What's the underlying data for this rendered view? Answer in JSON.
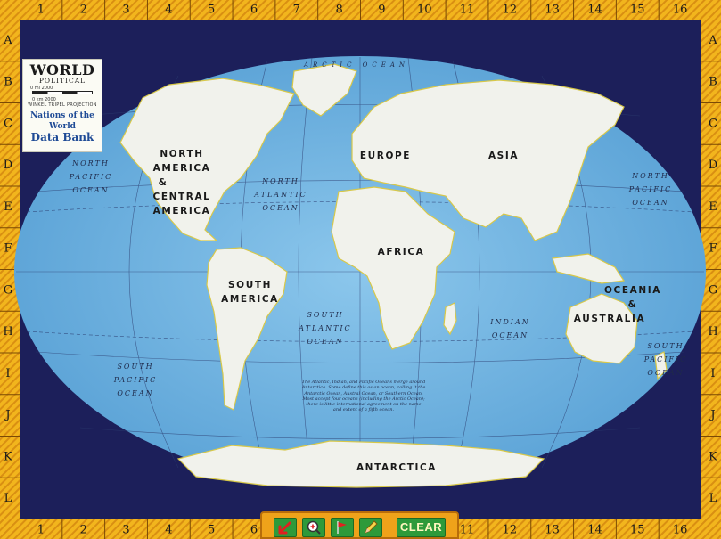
{
  "grid": {
    "columns": [
      "1",
      "2",
      "3",
      "4",
      "5",
      "6",
      "7",
      "8",
      "9",
      "10",
      "11",
      "12",
      "13",
      "14",
      "15",
      "16"
    ],
    "rows": [
      "A",
      "B",
      "C",
      "D",
      "E",
      "F",
      "G",
      "H",
      "I",
      "J",
      "K",
      "L"
    ]
  },
  "legend": {
    "title": "WORLD",
    "subtitle": "POLITICAL",
    "scale_mi": "0 mi          2000",
    "scale_km": "0 km        2000",
    "projection": "WINKEL TRIPEL PROJECTION",
    "brand_line1": "Nations of the World",
    "brand_line2": "Data Bank"
  },
  "continents": {
    "north_america": [
      "NORTH",
      "AMERICA",
      "&",
      "CENTRAL",
      "AMERICA"
    ],
    "south_america": [
      "SOUTH",
      "AMERICA"
    ],
    "europe": "EUROPE",
    "asia": "ASIA",
    "africa": "AFRICA",
    "oceania": [
      "OCEANIA",
      "&",
      "AUSTRALIA"
    ],
    "antarctica": "ANTARCTICA"
  },
  "oceans": {
    "north_pacific_w": [
      "NORTH",
      "PACIFIC",
      "OCEAN"
    ],
    "north_pacific_e": [
      "NORTH",
      "PACIFIC",
      "OCEAN"
    ],
    "north_atlantic": [
      "NORTH",
      "ATLANTIC",
      "OCEAN"
    ],
    "south_atlantic": [
      "SOUTH",
      "ATLANTIC",
      "OCEAN"
    ],
    "south_pacific": [
      "SOUTH",
      "PACIFIC",
      "OCEAN"
    ],
    "south_pacific_e": [
      "SOUTH",
      "PACIFIC",
      "OCEAN"
    ],
    "indian": [
      "INDIAN",
      "OCEAN"
    ],
    "arctic": "ARCTIC OCEAN"
  },
  "note": "The Atlantic, Indian, and Pacific Oceans merge around Antarctica. Some define this as an ocean, calling it the Antarctic Ocean, Austral Ocean, or Southern Ocean. Most accept four oceans (including the Arctic Ocean); there is little international agreement on the name and extent of a fifth ocean.",
  "toolbar": {
    "clear_label": "CLEAR"
  },
  "colors": {
    "frame": "#f2b51d",
    "border_navy": "#1c1f5a",
    "ocean": "#79b9e3",
    "land": "#f1f2ec",
    "toolbar": "#efa21a",
    "button": "#2e9a3a"
  }
}
